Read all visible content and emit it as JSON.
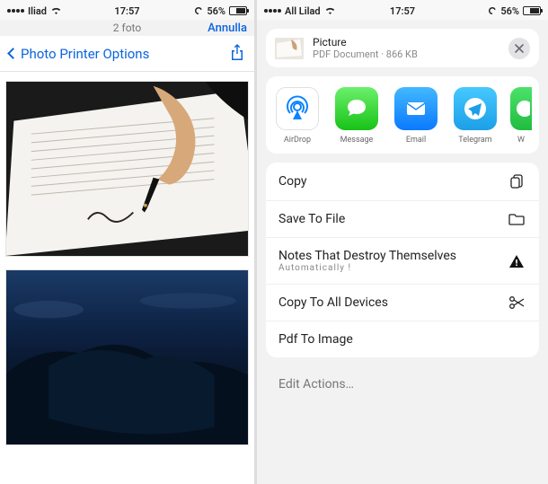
{
  "status": {
    "carrier_left": "Iliad",
    "carrier_right": "All Lilad",
    "time": "17:57",
    "battery_pct": "56%"
  },
  "left_pane": {
    "subhead_small": "2 foto",
    "cancel": "Annulla",
    "back_title": "Photo Printer Options",
    "preview_1_alt": "hand-signing-document",
    "preview_2_alt": "dark-island-seascape"
  },
  "right_pane": {
    "doc_title": "Picture",
    "doc_sub": "PDF Document · 866 KB",
    "share_apps": [
      {
        "id": "airdrop",
        "label": "AirDrop"
      },
      {
        "id": "messages",
        "label": "Message"
      },
      {
        "id": "mail",
        "label": "Email"
      },
      {
        "id": "telegram",
        "label": "Telegram"
      },
      {
        "id": "whatsapp",
        "label": "W"
      }
    ],
    "actions": {
      "copy": "Copy",
      "save_file": "Save To File",
      "notes_title": "Notes That Destroy Themselves",
      "notes_sub": "Automatically !",
      "copy_all": "Copy To All Devices",
      "pdf_img": "Pdf To Image"
    },
    "edit_actions": "Edit Actions…"
  }
}
